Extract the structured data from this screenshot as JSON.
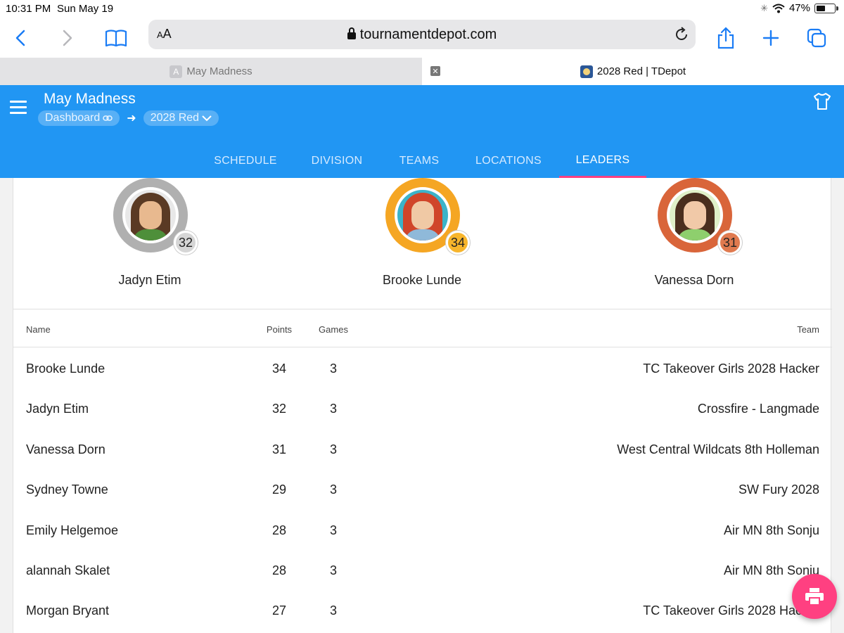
{
  "status": {
    "time": "10:31 PM",
    "date": "Sun May 19",
    "battery": "47%"
  },
  "browser": {
    "aa_label_small": "A",
    "aa_label": "A",
    "url": "tournamentdepot.com",
    "tabs": [
      {
        "label": "May Madness",
        "fav": "A"
      },
      {
        "label": "2028 Red | TDepot"
      }
    ]
  },
  "app": {
    "title": "May Madness",
    "breadcrumb": {
      "dashboard": "Dashboard",
      "current": "2028 Red"
    },
    "nav": [
      "SCHEDULE",
      "DIVISION",
      "TEAMS",
      "LOCATIONS",
      "LEADERS"
    ],
    "active_tab": "LEADERS",
    "accent": "#2196f3",
    "tab_indicator": "#ff4081"
  },
  "leaders": [
    {
      "name": "Jadyn Etim",
      "points": "32",
      "ring": "#b0b0b0",
      "badge": "#d6d6d6",
      "hair": "#5a3a24",
      "skin": "#e8b98f",
      "shirt": "#4e8f3a",
      "bg": "#e8e8e8"
    },
    {
      "name": "Brooke Lunde",
      "points": "34",
      "ring": "#f5a623",
      "badge": "#f7b52c",
      "hair": "#d0452a",
      "skin": "#f0c9a5",
      "shirt": "#8fb9d9",
      "bg": "#3bb3c9"
    },
    {
      "name": "Vanessa Dorn",
      "points": "31",
      "ring": "#d9653a",
      "badge": "#e07a4f",
      "hair": "#4a2e1e",
      "skin": "#f1c9a8",
      "shirt": "#8ecf6d",
      "bg": "#dff0c8"
    }
  ],
  "table": {
    "headers": {
      "name": "Name",
      "points": "Points",
      "games": "Games",
      "team": "Team"
    },
    "rows": [
      {
        "name": "Brooke Lunde",
        "points": "34",
        "games": "3",
        "team": "TC Takeover Girls 2028 Hacker"
      },
      {
        "name": "Jadyn Etim",
        "points": "32",
        "games": "3",
        "team": "Crossfire - Langmade"
      },
      {
        "name": "Vanessa Dorn",
        "points": "31",
        "games": "3",
        "team": "West Central Wildcats 8th Holleman"
      },
      {
        "name": "Sydney Towne",
        "points": "29",
        "games": "3",
        "team": "SW Fury 2028"
      },
      {
        "name": "Emily Helgemoe",
        "points": "28",
        "games": "3",
        "team": "Air MN 8th Sonju"
      },
      {
        "name": "alannah Skalet",
        "points": "28",
        "games": "3",
        "team": "Air MN 8th Sonju"
      },
      {
        "name": "Morgan Bryant",
        "points": "27",
        "games": "3",
        "team": "TC Takeover Girls 2028 Hacker"
      }
    ]
  },
  "icons": {
    "back": "chevron-left-icon",
    "forward": "chevron-right-icon",
    "bookmarks": "book-icon",
    "share": "share-icon",
    "new_tab": "plus-icon",
    "tabs": "tabs-icon",
    "reload": "reload-icon",
    "menu": "hamburger-icon",
    "jersey": "shirt-icon",
    "print": "print-icon",
    "link": "link-icon"
  }
}
